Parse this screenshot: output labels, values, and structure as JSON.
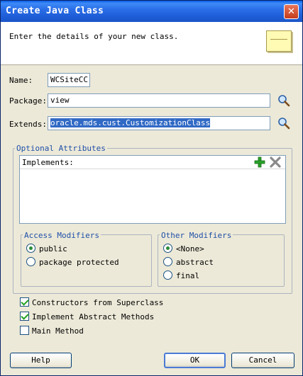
{
  "window": {
    "title": "Create Java Class"
  },
  "header": {
    "text": "Enter the details of your new class."
  },
  "form": {
    "name_label": "Name:",
    "name_value": "WCSiteCC",
    "package_label": "Package:",
    "package_value": "view",
    "extends_label": "Extends:",
    "extends_value": "oracle.mds.cust.CustomizationClass"
  },
  "optional": {
    "legend": "Optional Attributes",
    "implements_label": "Implements:"
  },
  "access": {
    "legend": "Access Modifiers",
    "options": [
      "public",
      "package protected"
    ],
    "selected": "public"
  },
  "other": {
    "legend": "Other Modifiers",
    "options": [
      "<None>",
      "abstract",
      "final"
    ],
    "selected": "<None>"
  },
  "checks": [
    {
      "label": "Constructors from Superclass",
      "checked": true
    },
    {
      "label": "Implement Abstract Methods",
      "checked": true
    },
    {
      "label": "Main Method",
      "checked": false
    }
  ],
  "buttons": {
    "help": "Help",
    "ok": "OK",
    "cancel": "Cancel"
  },
  "colors": {
    "title_bar": "#1f5fd9",
    "selection": "#316ac5",
    "legend_text": "#1f4fa8"
  },
  "icons": [
    "close-icon",
    "note-icon",
    "search-icon",
    "add-icon",
    "remove-icon"
  ]
}
